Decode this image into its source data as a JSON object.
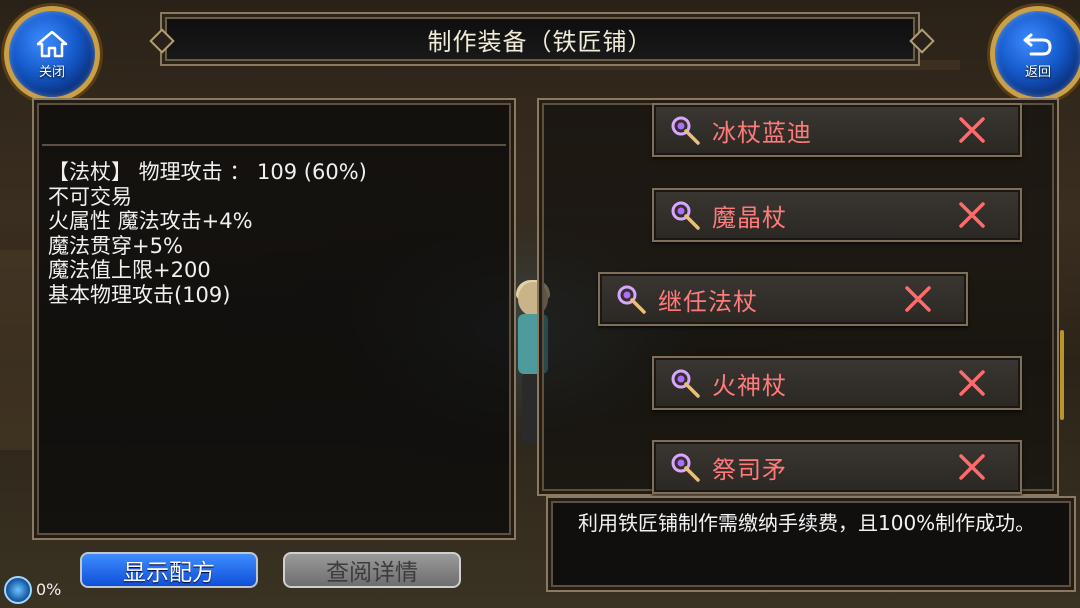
{
  "header": {
    "title": "制作装备（铁匠铺）",
    "close_label": "关闭",
    "back_label": "返回",
    "close_icon": "home-icon",
    "back_icon": "return-arrow-icon"
  },
  "item_stats": {
    "lines": [
      "【法杖】 物理攻击 ：  109 (60%)",
      "不可交易",
      "火属性 魔法攻击+4%",
      "魔法贯穿+5%",
      "魔法值上限+200",
      "基本物理攻击(109)"
    ]
  },
  "recipes": {
    "items": [
      {
        "name": "冰杖蓝迪",
        "icon": "staff-icon",
        "remove_icon": "close-x-icon"
      },
      {
        "name": "魔晶杖",
        "icon": "staff-icon",
        "remove_icon": "close-x-icon"
      },
      {
        "name": "继任法杖",
        "icon": "staff-icon",
        "remove_icon": "close-x-icon",
        "selected": true
      },
      {
        "name": "火神杖",
        "icon": "staff-icon",
        "remove_icon": "close-x-icon"
      },
      {
        "name": "祭司矛",
        "icon": "staff-icon",
        "remove_icon": "close-x-icon"
      }
    ]
  },
  "info": {
    "text": "利用铁匠铺制作需缴纳手续费，且100%制作成功。"
  },
  "buttons": {
    "show_recipe": "显示配方",
    "view_details": "查阅详情"
  },
  "status": {
    "progress": "0%"
  },
  "colors": {
    "recipe_name": "#ff7b7b",
    "accent_gold": "#c9a048",
    "button_blue": "#1458c8"
  }
}
